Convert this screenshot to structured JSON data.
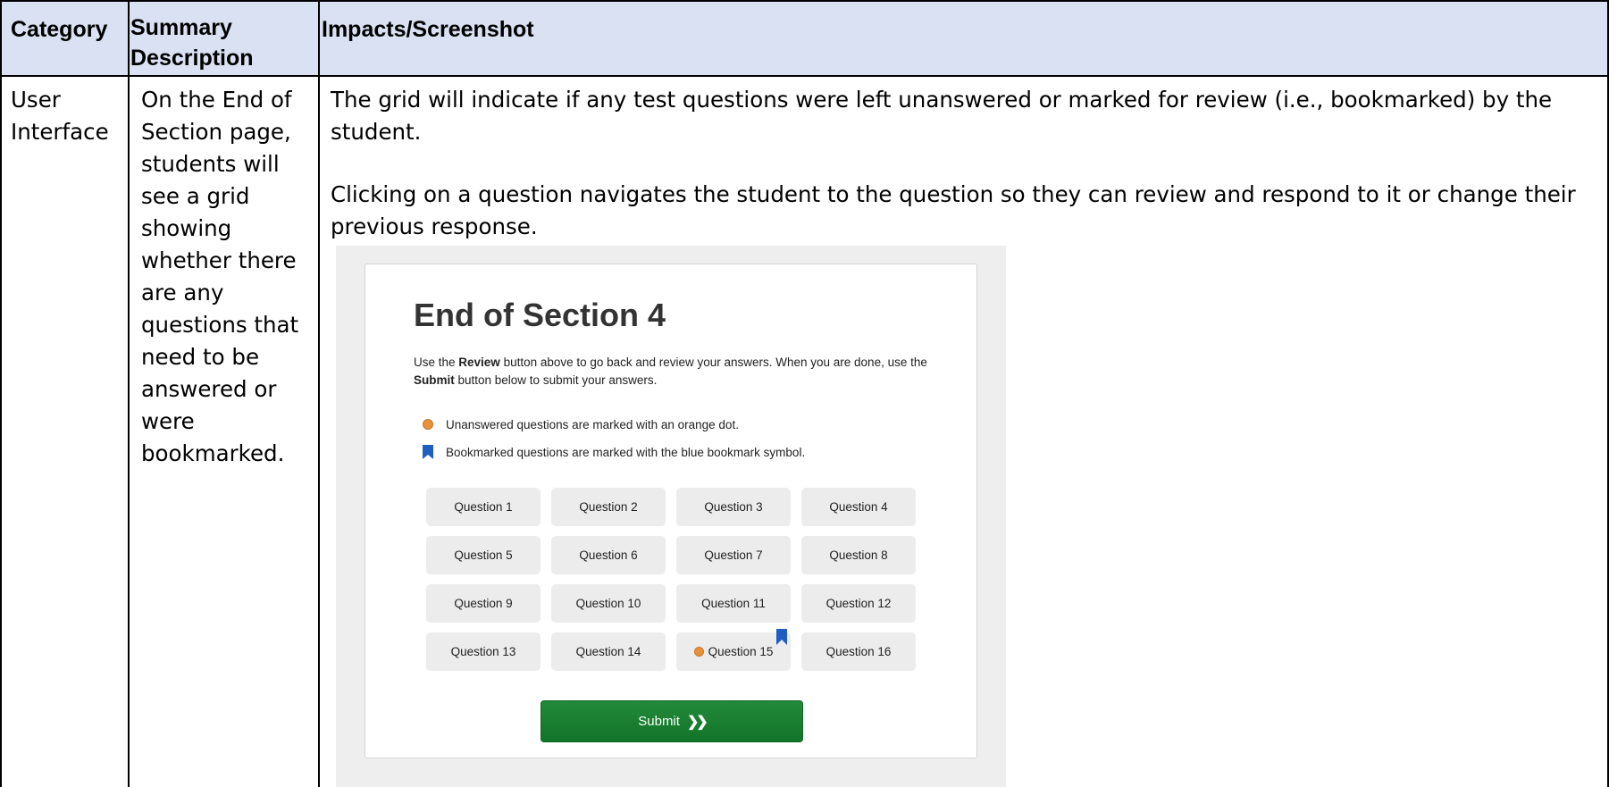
{
  "table": {
    "headers": {
      "category": "Category",
      "summary_line1": "Summary",
      "summary_line2": "Description",
      "impacts": "Impacts/Screenshot"
    },
    "row": {
      "category_lines": [
        "User",
        "Interface"
      ],
      "summary_lines": [
        "On the End of",
        "Section page,",
        "students will",
        "see a grid",
        "showing",
        "whether there",
        "are any",
        "questions that",
        "need to be",
        "answered or",
        "were",
        "bookmarked."
      ],
      "impacts_para1_line1": "The grid will indicate if any test questions were left unanswered or marked for review (i.e., bookmarked) by the",
      "impacts_para1_line2": "student.",
      "impacts_para2_line1": "Clicking on a question navigates the student to the question so they can review and respond to it or change their",
      "impacts_para2_line2": "previous response."
    }
  },
  "screenshot": {
    "title": "End of Section 4",
    "instruction_part1": "Use the ",
    "instruction_review": "Review",
    "instruction_part2": " button above to go back and review your answers. When you are done, use the ",
    "instruction_submit": "Submit",
    "instruction_part3": " button below to submit your answers.",
    "legend_unanswered": "Unanswered questions are marked with an orange dot.",
    "legend_bookmarked": "Bookmarked questions are marked with the blue bookmark symbol.",
    "questions": [
      {
        "label": "Question 1"
      },
      {
        "label": "Question 2"
      },
      {
        "label": "Question 3"
      },
      {
        "label": "Question 4"
      },
      {
        "label": "Question 5"
      },
      {
        "label": "Question 6"
      },
      {
        "label": "Question 7"
      },
      {
        "label": "Question 8"
      },
      {
        "label": "Question 9"
      },
      {
        "label": "Question 10"
      },
      {
        "label": "Question 11"
      },
      {
        "label": "Question 12"
      },
      {
        "label": "Question 13"
      },
      {
        "label": "Question 14"
      },
      {
        "label": "Question 15",
        "unanswered": true,
        "bookmarked": true
      },
      {
        "label": "Question 16"
      }
    ],
    "submit_label": "Submit",
    "submit_icon": "double-chevron-right-icon"
  },
  "colors": {
    "header_bg": "#d9e1f2",
    "unanswered_dot": "#e9913a",
    "bookmark": "#1f5fc4",
    "submit_green": "#1a7f33"
  }
}
